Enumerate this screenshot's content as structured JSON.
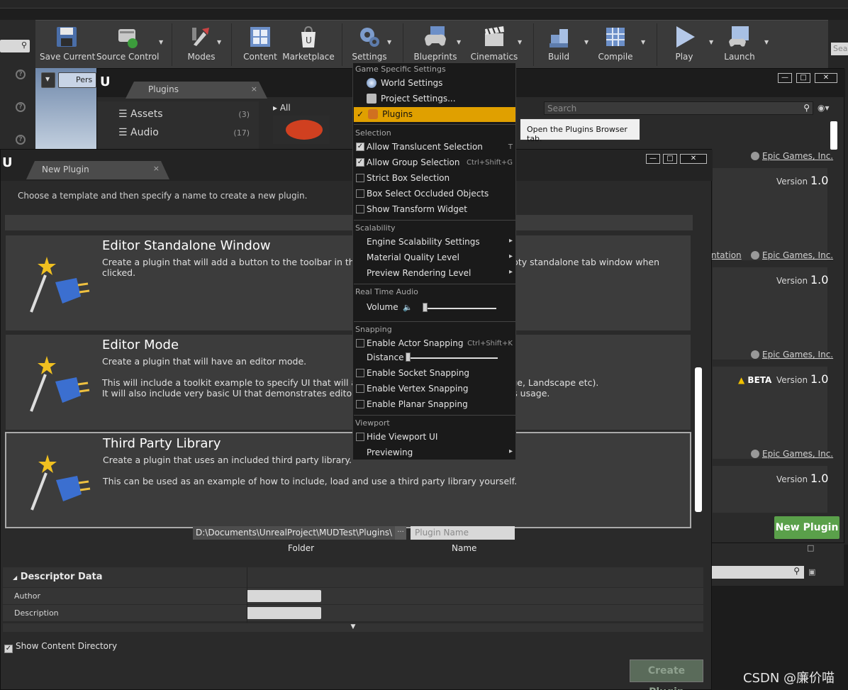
{
  "toolbar": {
    "items": [
      {
        "label": "Save Current",
        "icon": "floppy-disk-icon"
      },
      {
        "label": "Source Control",
        "icon": "source-control-icon"
      },
      {
        "label": "Modes",
        "icon": "modes-tools-icon"
      },
      {
        "label": "Content",
        "icon": "content-browser-icon"
      },
      {
        "label": "Marketplace",
        "icon": "marketplace-bag-icon"
      },
      {
        "label": "Settings",
        "icon": "settings-gears-icon"
      },
      {
        "label": "Blueprints",
        "icon": "blueprints-gamepad-icon"
      },
      {
        "label": "Cinematics",
        "icon": "cinematics-clapper-icon"
      },
      {
        "label": "Build",
        "icon": "build-blocks-icon"
      },
      {
        "label": "Compile",
        "icon": "compile-cube-icon"
      },
      {
        "label": "Play",
        "icon": "play-triangle-icon"
      },
      {
        "label": "Launch",
        "icon": "launch-monitor-icon"
      }
    ]
  },
  "viewport": {
    "perspective_label": "Pers"
  },
  "plugins_window": {
    "tab_label": "Plugins",
    "categories": [
      {
        "label": "Assets",
        "count": "(3)"
      },
      {
        "label": "Audio",
        "count": "(17)"
      }
    ],
    "breadcrumb": "All",
    "search_placeholder": "Search",
    "publisher": "Epic Games, Inc.",
    "version_label": "Version",
    "version_number": "1.0",
    "beta_label": "BETA",
    "doc_link_fragment": "ntation",
    "new_plugin_button": "New Plugin"
  },
  "new_plugin_window": {
    "tab_label": "New Plugin",
    "description": "Choose a template and then specify a name to create a new plugin.",
    "templates": [
      {
        "name": "Editor Standalone Window",
        "desc": "Create a plugin that will add a button to the toolbar in the Level Editor that summons an empty standalone tab window when clicked.",
        "selected": false
      },
      {
        "name": "Editor Mode",
        "desc": "Create a plugin that will have an editor mode.\n\nThis will include a toolkit example to specify UI that will appear in \"Modes\" tab (next to Foliage, Landscape etc).\nIt will also include very basic UI that demonstrates editor interaction and undo/redo functions usage.",
        "selected": false
      },
      {
        "name": "Third Party Library",
        "desc": "Create a plugin that uses an included third party library.\n\nThis can be used as an example of how to include, load and use a third party library yourself.",
        "selected": true
      }
    ],
    "folder_value": "D:\\Documents\\UnrealProject\\MUDTest\\Plugins\\",
    "folder_browse": "...",
    "name_placeholder": "Plugin Name",
    "folder_label": "Folder",
    "name_label": "Name",
    "descriptor_header": "Descriptor Data",
    "descriptor_rows": [
      {
        "label": "Author"
      },
      {
        "label": "Description"
      }
    ],
    "show_content_directory": "Show Content Directory",
    "show_content_checked": true,
    "create_button": "Create Plugin"
  },
  "settings_menu": {
    "sec_game": "Game Specific Settings",
    "world_settings": "World Settings",
    "project_settings": "Project Settings...",
    "plugins": "Plugins",
    "sec_selection": "Selection",
    "allow_translucent": "Allow Translucent Selection",
    "allow_translucent_sc": "T",
    "allow_group": "Allow Group Selection",
    "allow_group_sc": "Ctrl+Shift+G",
    "strict_box": "Strict Box Selection",
    "box_occluded": "Box Select Occluded Objects",
    "show_transform": "Show Transform Widget",
    "sec_scalability": "Scalability",
    "engine_scal": "Engine Scalability Settings",
    "material_quality": "Material Quality Level",
    "preview_rendering": "Preview Rendering Level",
    "sec_audio": "Real Time Audio",
    "volume": "Volume",
    "volume_level": 0.0,
    "sec_snapping": "Snapping",
    "actor_snapping": "Enable Actor Snapping",
    "actor_snapping_sc": "Ctrl+Shift+K",
    "distance": "Distance",
    "distance_level": 0.0,
    "socket_snapping": "Enable Socket Snapping",
    "vertex_snapping": "Enable Vertex Snapping",
    "planar_snapping": "Enable Planar Snapping",
    "sec_viewport": "Viewport",
    "hide_viewport_ui": "Hide Viewport UI",
    "previewing": "Previewing"
  },
  "tooltip": "Open the Plugins Browser tab.",
  "right_strip_search": "Sea",
  "watermark": "CSDN @廉价喵",
  "colors": {
    "highlight": "#e0a000",
    "new_plugin_green": "#5aa04a"
  }
}
